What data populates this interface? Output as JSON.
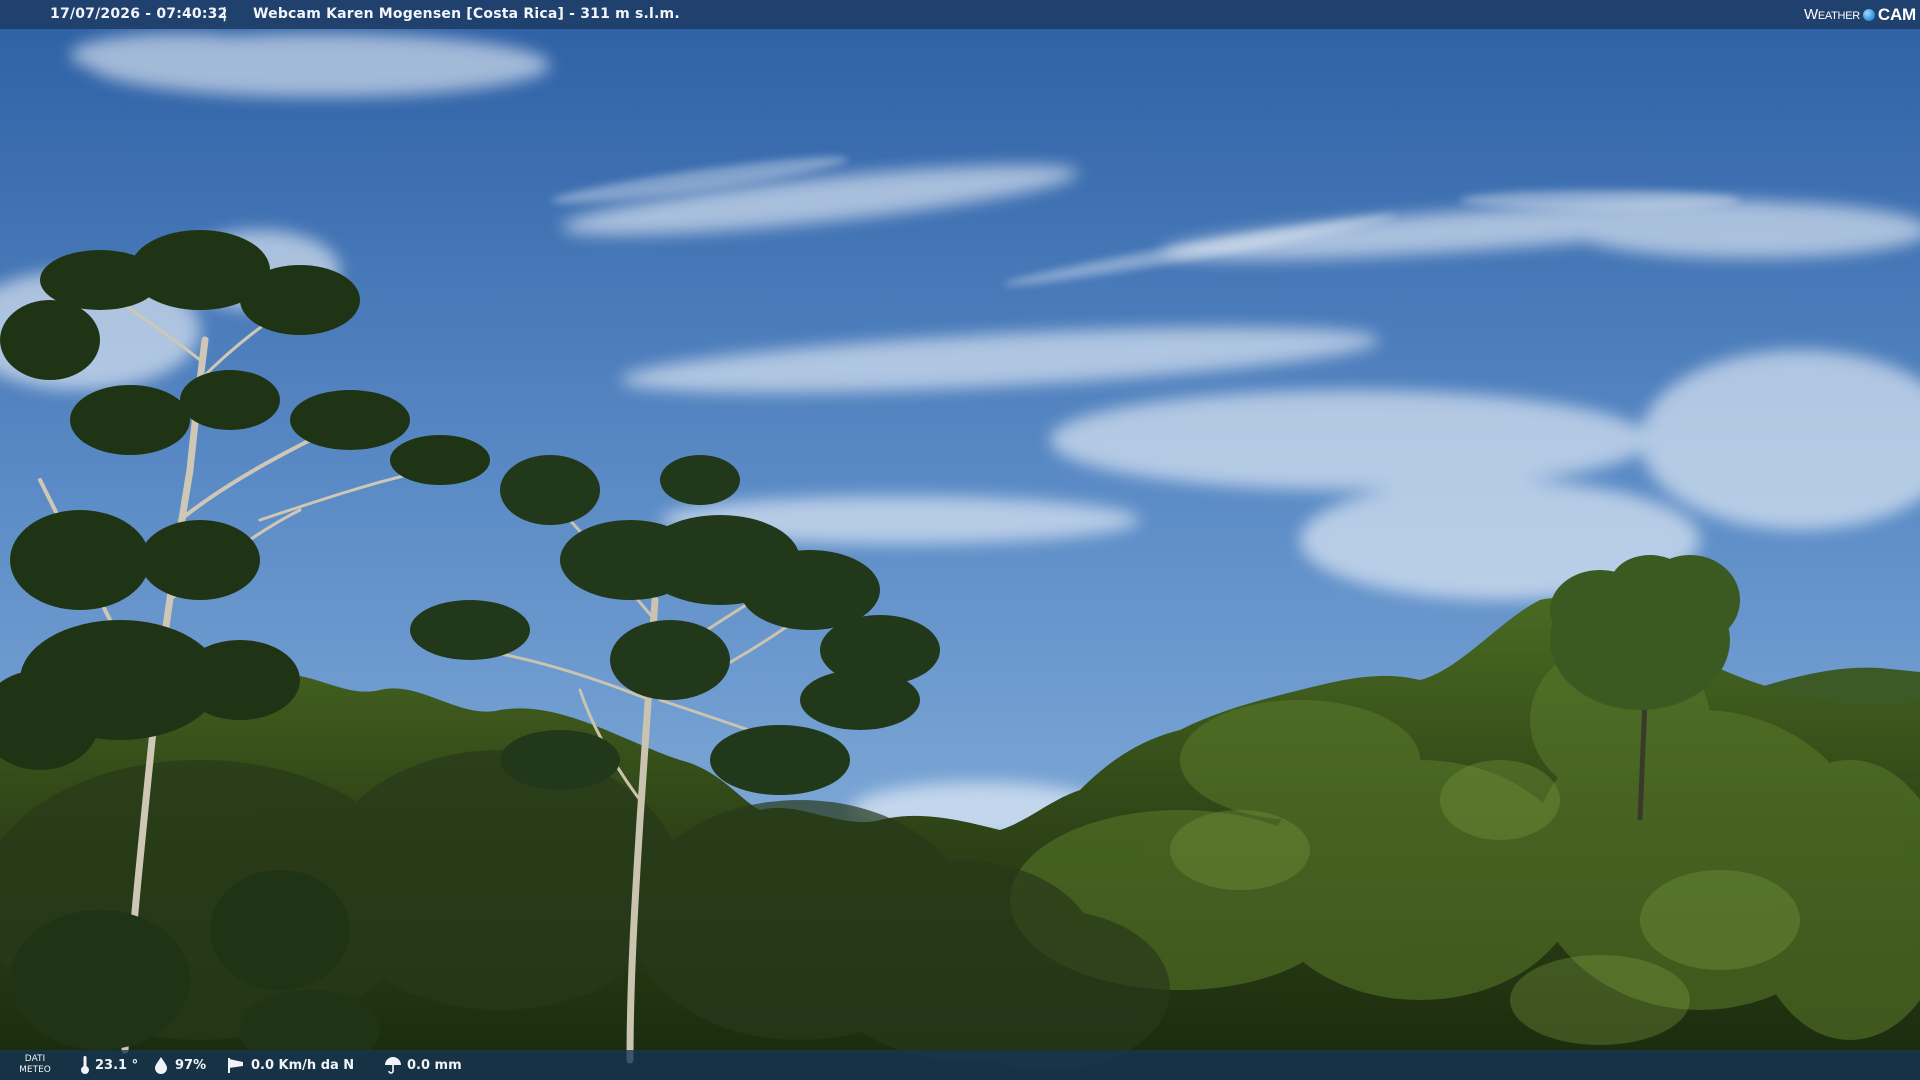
{
  "header": {
    "timestamp": "17/07/2026 - 07:40:32",
    "separator": "|",
    "title": "Webcam Karen Mogensen [Costa Rica] - 311 m s.l.m.",
    "brand_left": "Weather",
    "brand_right": "CAM"
  },
  "footer": {
    "meteo_line1": "DATI",
    "meteo_line2": "METEO",
    "temperature": "23.1 °",
    "humidity": "97%",
    "wind": "0.0 Km/h da N",
    "rain": "0.0 mm"
  },
  "icons": {
    "temperature": "thermometer-icon",
    "humidity": "droplet-icon",
    "wind": "windsock-icon",
    "rain": "umbrella-icon",
    "brand": "globe-icon"
  },
  "colors": {
    "sky_top": "#2f63a8",
    "sky_mid": "#5f8ec8",
    "sky_low": "#7ea8d6",
    "foliage_dark": "#1c2e12",
    "foliage_mid": "#3d5a1f",
    "foliage_light": "#6f8f35"
  }
}
